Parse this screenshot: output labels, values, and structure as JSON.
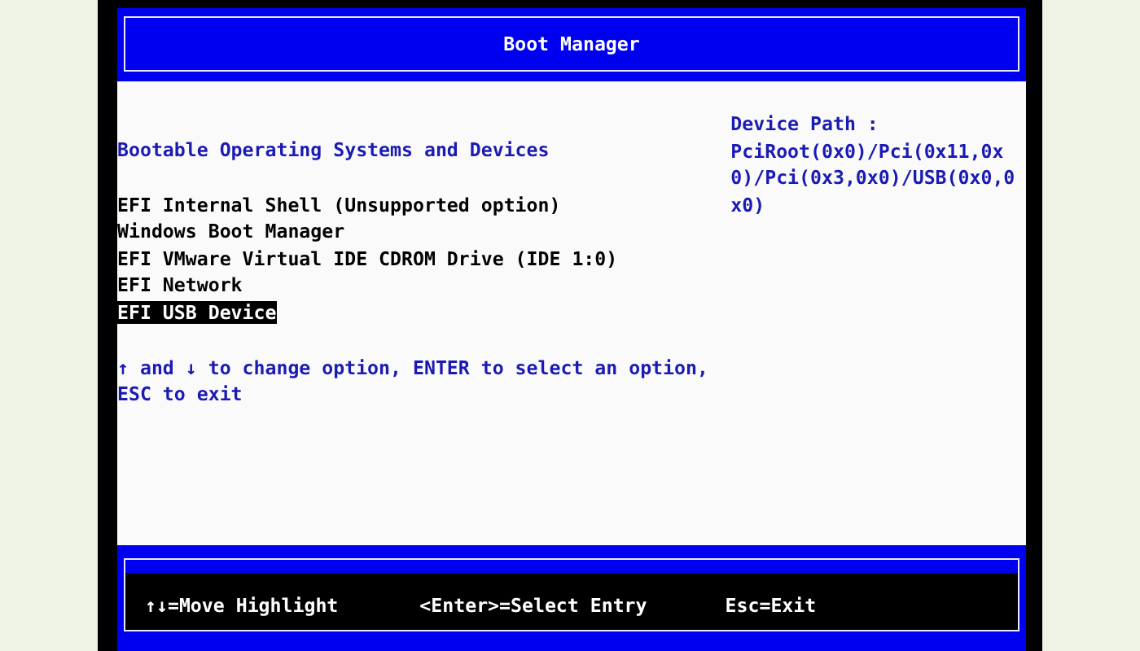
{
  "title": "Boot Manager",
  "section_heading": "Bootable Operating Systems and Devices",
  "boot_options": [
    {
      "label": "EFI Internal Shell (Unsupported option)",
      "selected": false
    },
    {
      "label": "Windows Boot Manager",
      "selected": false
    },
    {
      "label": "EFI VMware Virtual IDE CDROM Drive (IDE 1:0)",
      "selected": false
    },
    {
      "label": "EFI Network",
      "selected": false
    },
    {
      "label": "EFI USB Device",
      "selected": true
    }
  ],
  "help_text": "↑ and ↓ to change option, ENTER to select an option, ESC to exit",
  "device_path": {
    "label": "Device Path :",
    "value": "PciRoot(0x0)/Pci(0x11,0x0)/Pci(0x3,0x0)/USB(0x0,0x0)"
  },
  "key_hints": [
    "↑↓=Move Highlight",
    "<Enter>=Select Entry",
    "Esc=Exit"
  ]
}
